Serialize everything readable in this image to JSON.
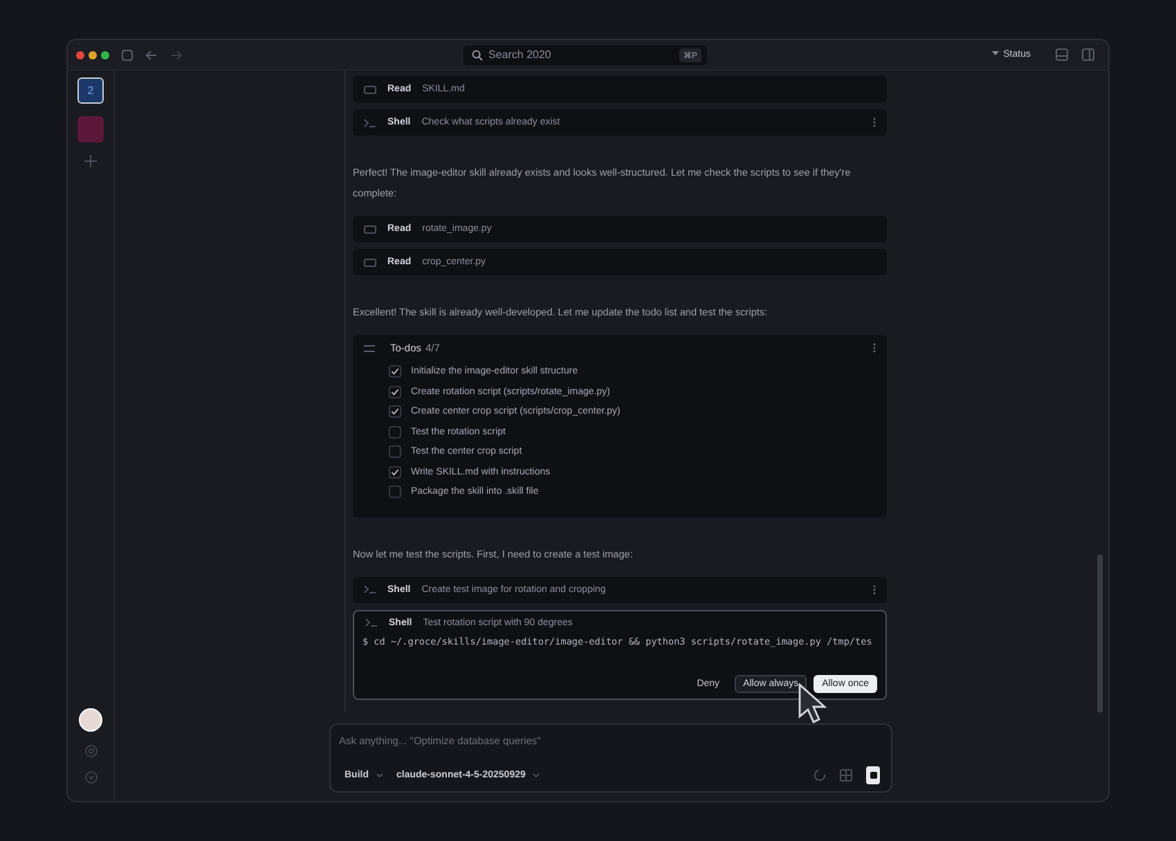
{
  "titlebar": {
    "search": {
      "placeholder": "Search 2020",
      "shortcut": "⌘P"
    },
    "status_label": "Status"
  },
  "rail": {
    "workspaces": [
      {
        "label": "2",
        "selected": true,
        "color": "#1c3868"
      },
      {
        "selected": false,
        "color": "#5c1838"
      }
    ]
  },
  "feed": [
    {
      "kind": "read",
      "action": "Read",
      "detail": "SKILL.md",
      "has_menu": false
    },
    {
      "kind": "shell",
      "action": "Shell",
      "detail": "Check what scripts already exist",
      "has_menu": true
    },
    {
      "kind": "text",
      "text": "Perfect! The image-editor skill already exists and looks well-structured. Let me check the scripts to see if they're complete:"
    },
    {
      "kind": "read",
      "action": "Read",
      "detail": "rotate_image.py",
      "has_menu": false
    },
    {
      "kind": "read",
      "action": "Read",
      "detail": "crop_center.py",
      "has_menu": false
    },
    {
      "kind": "text",
      "text": "Excellent! The skill is already well-developed. Let me update the todo list and test the scripts:"
    },
    {
      "kind": "todos",
      "title": "To-dos",
      "count": "4/7",
      "items": [
        {
          "text": "Initialize the image-editor skill structure",
          "checked": true
        },
        {
          "text": "Create rotation script (scripts/rotate_image.py)",
          "checked": true
        },
        {
          "text": "Create center crop script (scripts/crop_center.py)",
          "checked": true
        },
        {
          "text": "Test the rotation script",
          "checked": false
        },
        {
          "text": "Test the center crop script",
          "checked": false
        },
        {
          "text": "Write SKILL.md with instructions",
          "checked": true
        },
        {
          "text": "Package the skill into .skill file",
          "checked": false
        }
      ]
    },
    {
      "kind": "text",
      "text": "Now let me test the scripts. First, I need to create a test image:"
    },
    {
      "kind": "shell",
      "action": "Shell",
      "detail": "Create test image for rotation and cropping",
      "has_menu": true
    },
    {
      "kind": "approval",
      "action": "Shell",
      "detail": "Test rotation script with 90 degrees",
      "command": "$ cd ~/.groce/skills/image-editor/image-editor && python3 scripts/rotate_image.py /tmp/tes",
      "buttons": [
        {
          "label": "Deny",
          "kind": "text"
        },
        {
          "label": "Allow always",
          "kind": "outline"
        },
        {
          "label": "Allow once",
          "kind": "primary"
        }
      ]
    }
  ],
  "composer": {
    "placeholder": "Ask anything... \"Optimize database queries\"",
    "mode": "Build",
    "model": "claude-sonnet-4-5-20250929"
  }
}
